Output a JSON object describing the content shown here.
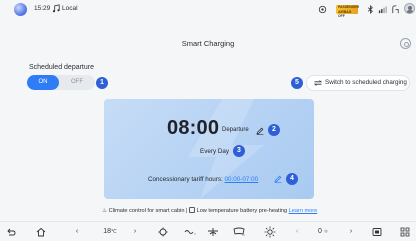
{
  "status_bar": {
    "time": "15:29",
    "media_source": "Local",
    "icons": [
      "location-icon",
      "bluetooth-icon",
      "signal-icon",
      "car-icon"
    ],
    "badge_text": "PASSENGER AIRBAG OFF"
  },
  "header": {
    "title": "Smart Charging"
  },
  "scheduled_departure": {
    "label": "Scheduled departure",
    "on_label": "ON",
    "off_label": "OFF",
    "state": "on",
    "marker": "1"
  },
  "switch_button": {
    "label": "Switch to scheduled charging",
    "marker": "5"
  },
  "card": {
    "departure_time": "08:00",
    "departure_label": "Departure",
    "departure_marker": "2",
    "repeat": "Every Day",
    "repeat_marker": "3",
    "tariff_label": "Concessionary tariff hours:",
    "tariff_value": "00:00-07:00",
    "tariff_marker": "4"
  },
  "info": {
    "climate_text": "Climate control for smart cabin",
    "separator": "|",
    "battery_text": "Low temperature battery pre-heating",
    "learn_more": "Learn more"
  },
  "dock": {
    "left_temp": "18",
    "left_temp_unit": "℃",
    "right_temp": "0",
    "colors": {
      "accent": "#2f7df6",
      "marker": "#2e5fd6"
    }
  }
}
